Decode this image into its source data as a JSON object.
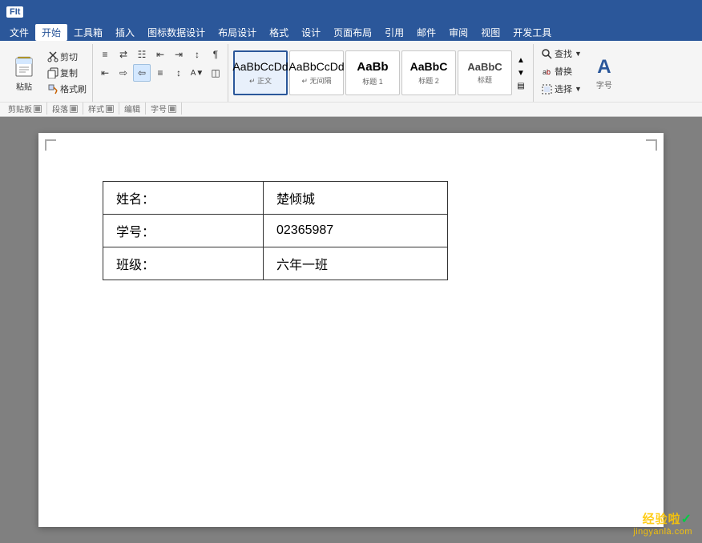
{
  "titlebar": {
    "label": "FIt"
  },
  "menubar": {
    "items": [
      "文件",
      "开始",
      "工具箱",
      "插入",
      "图标数据设计",
      "布局设计",
      "格式",
      "设计",
      "页面布局",
      "引用",
      "邮件",
      "审阅",
      "视图",
      "开发工具"
    ]
  },
  "ribbon": {
    "groups": {
      "clipboard": {
        "label": "剪贴板",
        "paste_label": "粘贴",
        "cut_label": "剪切",
        "copy_label": "复制",
        "format_painter_label": "格式刷"
      },
      "paragraph": {
        "label": "段落"
      },
      "styles": {
        "label": "样式",
        "items": [
          {
            "preview": "AaBbCcDd",
            "label": "↵ 正文",
            "active": true
          },
          {
            "preview": "AaBbCcDd",
            "label": "↵ 无间隔"
          },
          {
            "preview": "AaBb",
            "label": "标题 1"
          },
          {
            "preview": "AaBbC",
            "label": "标题 2"
          },
          {
            "preview": "AaBbC",
            "label": "标题"
          }
        ]
      },
      "editing": {
        "label": "编辑",
        "find_label": "查找",
        "replace_label": "替换",
        "select_label": "选择"
      },
      "character": {
        "label": "字号"
      }
    }
  },
  "document": {
    "table": {
      "rows": [
        {
          "label": "姓名：",
          "value": "楚倾城"
        },
        {
          "label": "学号：",
          "value": "02365987"
        },
        {
          "label": "班级：",
          "value": "六年一班"
        }
      ]
    }
  },
  "watermark": {
    "line1": "经验啦✓",
    "line2": "jingyanlà.com"
  }
}
